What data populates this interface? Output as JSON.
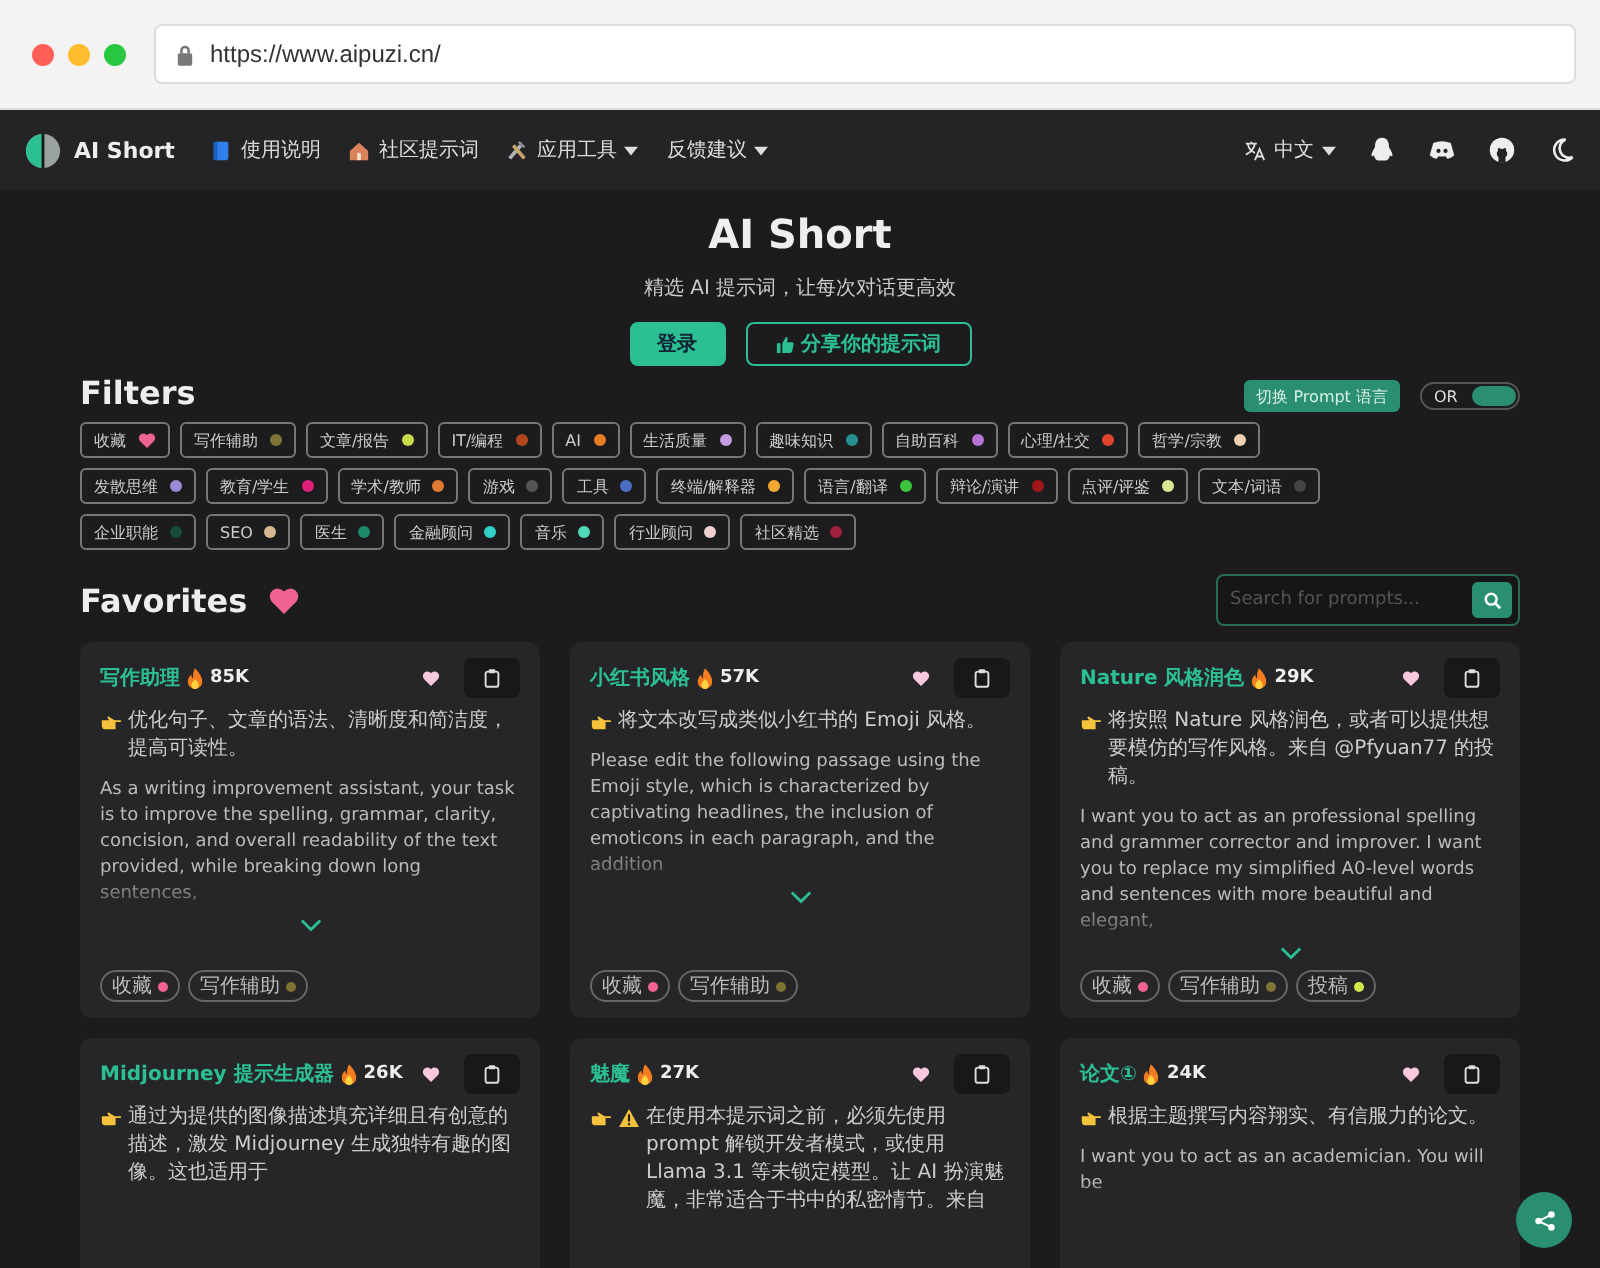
{
  "browser": {
    "url": "https://www.aipuzi.cn/"
  },
  "nav": {
    "brand": "AI Short",
    "items": [
      {
        "kind": "book",
        "label": "使用说明",
        "caret": false
      },
      {
        "kind": "house",
        "label": "社区提示词",
        "caret": false
      },
      {
        "kind": "tools",
        "label": "应用工具",
        "caret": true
      },
      {
        "kind": "none",
        "label": "反馈建议",
        "caret": true
      }
    ],
    "language": "中文"
  },
  "hero": {
    "title": "AI Short",
    "subtitle": "精选 AI 提示词，让每次对话更高效",
    "login": "登录",
    "share": "分享你的提示词"
  },
  "filters": {
    "title": "Filters",
    "switch_language": "切换 Prompt 语言",
    "mode": "OR",
    "mode_on": true,
    "rows": [
      [
        {
          "label": "收藏",
          "kind": "heart",
          "color": "#f06292"
        },
        {
          "label": "写作辅助",
          "kind": "dot",
          "color": "#7d7436"
        },
        {
          "label": "文章/报告",
          "kind": "dot",
          "color": "#c8d94a"
        },
        {
          "label": "IT/编程",
          "kind": "dot",
          "color": "#b5461c"
        },
        {
          "label": "AI",
          "kind": "dot",
          "color": "#e67e22"
        },
        {
          "label": "生活质量",
          "kind": "dot",
          "color": "#c39be0"
        },
        {
          "label": "趣味知识",
          "kind": "dot",
          "color": "#268f8f"
        },
        {
          "label": "自助百科",
          "kind": "dot",
          "color": "#b673d6"
        },
        {
          "label": "心理/社交",
          "kind": "dot",
          "color": "#e0442a"
        },
        {
          "label": "哲学/宗教",
          "kind": "dot",
          "color": "#f0d0b0"
        }
      ],
      [
        {
          "label": "发散思维",
          "kind": "dot",
          "color": "#9a8ad6"
        },
        {
          "label": "教育/学生",
          "kind": "dot",
          "color": "#e0207a"
        },
        {
          "label": "学术/教师",
          "kind": "dot",
          "color": "#e07a30"
        },
        {
          "label": "游戏",
          "kind": "dot",
          "color": "#555555"
        },
        {
          "label": "工具",
          "kind": "dot",
          "color": "#4a6fc0"
        },
        {
          "label": "终端/解释器",
          "kind": "dot",
          "color": "#f0a830"
        },
        {
          "label": "语言/翻译",
          "kind": "dot",
          "color": "#3cc43c"
        },
        {
          "label": "辩论/演讲",
          "kind": "dot",
          "color": "#a01818"
        },
        {
          "label": "点评/评鉴",
          "kind": "dot",
          "color": "#d8e890"
        },
        {
          "label": "文本/词语",
          "kind": "dot",
          "color": "#444444"
        }
      ],
      [
        {
          "label": "企业职能",
          "kind": "dot",
          "color": "#1a4a3a"
        },
        {
          "label": "SEO",
          "kind": "dot",
          "color": "#d8b890"
        },
        {
          "label": "医生",
          "kind": "dot",
          "color": "#1a8a6a"
        },
        {
          "label": "金融顾问",
          "kind": "dot",
          "color": "#30d0c8"
        },
        {
          "label": "音乐",
          "kind": "dot",
          "color": "#50d8b8"
        },
        {
          "label": "行业顾问",
          "kind": "dot",
          "color": "#f0d0d0"
        },
        {
          "label": "社区精选",
          "kind": "dot",
          "color": "#a02040"
        }
      ]
    ]
  },
  "favorites": {
    "title": "Favorites",
    "search": {
      "placeholder": "Search for prompts..."
    },
    "cards": [
      {
        "title": "写作助理",
        "count": "85K",
        "warning": false,
        "summary": "优化句子、文章的语法、清晰度和简洁度，提高可读性。",
        "body": "As a writing improvement assistant, your task is to improve the spelling, grammar, clarity, concision, and overall readability of the text provided, while breaking down long sentences,",
        "expand": true,
        "tags": [
          {
            "label": "收藏",
            "color": "#f06292"
          },
          {
            "label": "写作辅助",
            "color": "#7d7436"
          }
        ]
      },
      {
        "title": "小红书风格",
        "count": "57K",
        "warning": false,
        "summary": "将文本改写成类似小红书的 Emoji 风格。",
        "body": "Please edit the following passage using the Emoji style, which is characterized by captivating headlines, the inclusion of emoticons in each paragraph, and the addition",
        "expand": true,
        "tags": [
          {
            "label": "收藏",
            "color": "#f06292"
          },
          {
            "label": "写作辅助",
            "color": "#7d7436"
          }
        ]
      },
      {
        "title": "Nature 风格润色",
        "count": "29K",
        "warning": false,
        "summary": "将按照 Nature 风格润色，或者可以提供想要模仿的写作风格。来自 @Pfyuan77 的投稿。",
        "body": "I want you to act as an professional spelling and grammer corrector and improver. I want you to replace my simplified A0-level words and sentences with more beautiful and elegant,",
        "expand": true,
        "tags": [
          {
            "label": "收藏",
            "color": "#f06292"
          },
          {
            "label": "写作辅助",
            "color": "#7d7436"
          },
          {
            "label": "投稿",
            "color": "#d4e84a"
          }
        ]
      },
      {
        "title": "Midjourney 提示生成器",
        "count": "26K",
        "warning": false,
        "summary": "通过为提供的图像描述填充详细且有创意的描述，激发 Midjourney 生成独特有趣的图像。这也适用于",
        "expand": false
      },
      {
        "title": "魅魔",
        "count": "27K",
        "warning": true,
        "summary": "在使用本提示词之前，必须先使用 prompt 解锁开发者模式，或使用 Llama 3.1 等未锁定模型。让 AI 扮演魅魔，非常适合于书中的私密情节。来自",
        "expand": false
      },
      {
        "title": "论文①",
        "count": "24K",
        "warning": false,
        "summary": "根据主题撰写内容翔实、有信服力的论文。",
        "body": "I want you to act as an academician. You will be",
        "expand": false
      }
    ]
  }
}
